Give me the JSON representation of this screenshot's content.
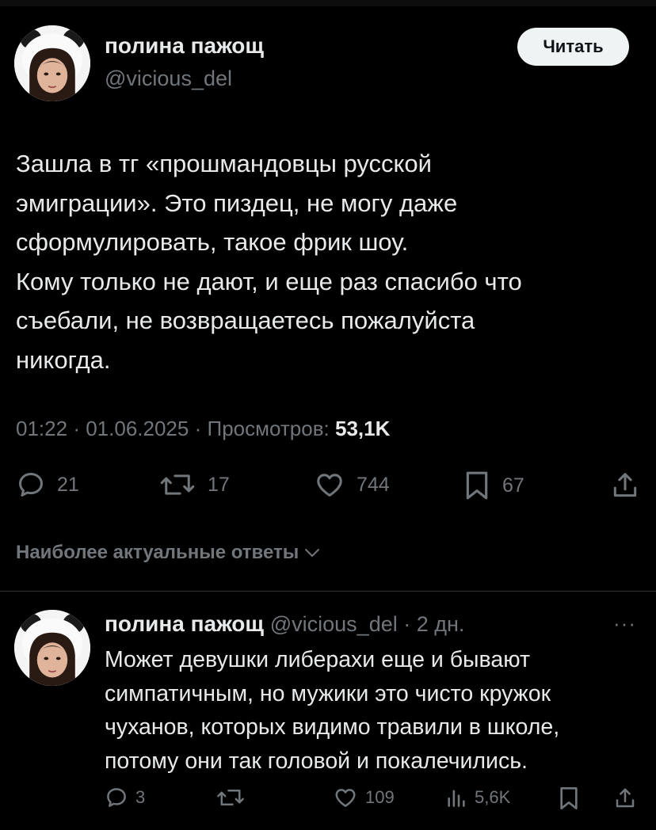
{
  "tweet": {
    "author_name": "полина пажощ",
    "author_handle": "@vicious_del",
    "follow_label": "Читать",
    "text_lines": [
      "Зашла в тг «прошмандовцы русской",
      "эмиграции». Это пиздец, не могу даже",
      "сформулировать, такое фрик шоу.",
      "Кому только не дают, и еще раз спасибо что",
      "съебали, не возвращаетесь пожалуйста",
      "никогда."
    ],
    "time": "01:22",
    "date": "01.06.2025",
    "views_label": "Просмотров:",
    "views_count": "53,1K",
    "separator": "·",
    "actions": {
      "replies": "21",
      "reposts": "17",
      "likes": "744",
      "bookmarks": "67"
    }
  },
  "replies_sort": {
    "label": "Наиболее актуальные ответы"
  },
  "reply": {
    "author_name": "полина пажощ",
    "author_handle": "@vicious_del",
    "time_ago": "2 дн.",
    "more": "···",
    "text_lines": [
      "Может девушки либерахи еще и бывают",
      "симпатичным, но мужики это чисто кружок",
      "чуханов, которых видимо травили в школе,",
      "потому они так головой и покалечились."
    ],
    "actions": {
      "replies": "3",
      "likes": "109",
      "views": "5,6K"
    }
  },
  "colors": {
    "background": "#000000",
    "text": "#e7e9ea",
    "secondary": "#71767b",
    "divider": "#2f3336",
    "button_bg": "#eff3f4"
  },
  "icons": [
    "reply-icon",
    "repost-icon",
    "like-icon",
    "bookmark-icon",
    "share-icon",
    "views-icon",
    "chevron-down-icon"
  ]
}
